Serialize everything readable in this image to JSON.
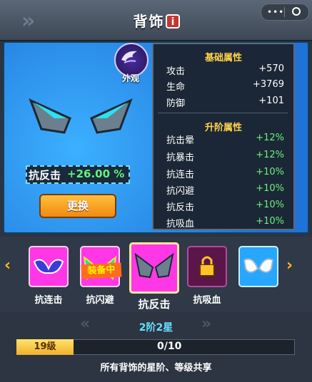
{
  "header": {
    "title": "背饰",
    "info_icon": "i"
  },
  "mini_program": {
    "more": "•••"
  },
  "appearance": {
    "label": "外观"
  },
  "current": {
    "stat_label": "抗反击",
    "stat_value": "+26.00 %",
    "upgrade_label": "更换"
  },
  "base_attrs": {
    "title": "基础属性",
    "rows": [
      {
        "name": "攻击",
        "value": "+570"
      },
      {
        "name": "生命",
        "value": "+3769"
      },
      {
        "name": "防御",
        "value": "+101"
      }
    ]
  },
  "advance_attrs": {
    "title": "升阶属性",
    "rows": [
      {
        "name": "抗击晕",
        "value": "+12%"
      },
      {
        "name": "抗暴击",
        "value": "+12%"
      },
      {
        "name": "抗连击",
        "value": "+10%"
      },
      {
        "name": "抗闪避",
        "value": "+10%"
      },
      {
        "name": "抗反击",
        "value": "+10%"
      },
      {
        "name": "抗吸血",
        "value": "+10%"
      }
    ]
  },
  "items": [
    {
      "label": "抗连击",
      "color": "#ff3be6"
    },
    {
      "label": "抗闪避",
      "color": "#ff3be6",
      "badge": "装备中"
    },
    {
      "label": "抗反击",
      "color": "#ff3be6"
    },
    {
      "label": "抗吸血",
      "color": "#7a1d6e"
    },
    {
      "label": "",
      "color": "#27a7ff"
    }
  ],
  "progress": {
    "grade": "2阶2星",
    "level": "19级",
    "text": "0/10",
    "fraction": 0
  },
  "footer": {
    "note": "所有背饰的星阶、等级共享"
  }
}
